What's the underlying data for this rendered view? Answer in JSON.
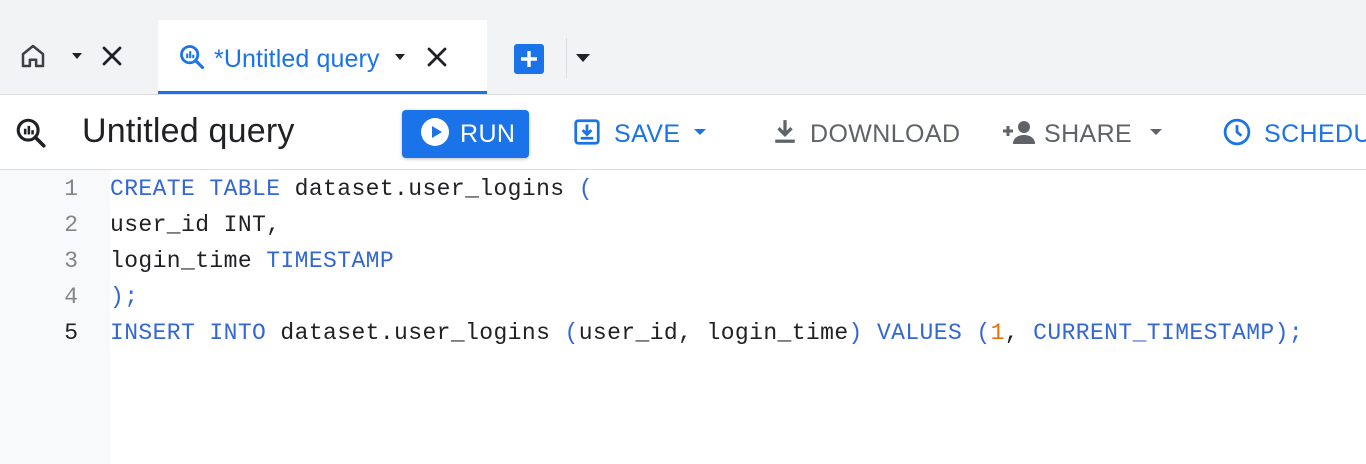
{
  "tabs": {
    "active": {
      "title": "*Untitled query"
    }
  },
  "toolbar": {
    "query_title": "Untitled query",
    "run_label": "RUN",
    "save_label": "SAVE",
    "download_label": "DOWNLOAD",
    "share_label": "SHARE",
    "schedule_label": "SCHEDULE"
  },
  "editor": {
    "line_numbers": [
      "1",
      "2",
      "3",
      "4",
      "5"
    ],
    "current_line": 5,
    "lines": [
      [
        {
          "t": "CREATE",
          "c": "kw"
        },
        {
          "t": " "
        },
        {
          "t": "TABLE",
          "c": "kw"
        },
        {
          "t": " dataset.user_logins "
        },
        {
          "t": "(",
          "c": "pun"
        }
      ],
      [
        {
          "t": "user_id INT,"
        }
      ],
      [
        {
          "t": "login_time "
        },
        {
          "t": "TIMESTAMP",
          "c": "kw"
        }
      ],
      [
        {
          "t": ");",
          "c": "pun"
        }
      ],
      [
        {
          "t": "INSERT",
          "c": "kw"
        },
        {
          "t": " "
        },
        {
          "t": "INTO",
          "c": "kw"
        },
        {
          "t": " dataset.user_logins "
        },
        {
          "t": "(",
          "c": "pun"
        },
        {
          "t": "user_id, login_time"
        },
        {
          "t": ")",
          "c": "pun"
        },
        {
          "t": " "
        },
        {
          "t": "VALUES",
          "c": "kw"
        },
        {
          "t": " "
        },
        {
          "t": "(",
          "c": "pun"
        },
        {
          "t": "1",
          "c": "num"
        },
        {
          "t": ", "
        },
        {
          "t": "CURRENT_TIMESTAMP",
          "c": "kw"
        },
        {
          "t": ");",
          "c": "pun"
        }
      ]
    ]
  },
  "colors": {
    "accent": "#1a73e8",
    "keyword": "#3367d6",
    "number": "#e8710a",
    "muted": "#5f6368"
  }
}
